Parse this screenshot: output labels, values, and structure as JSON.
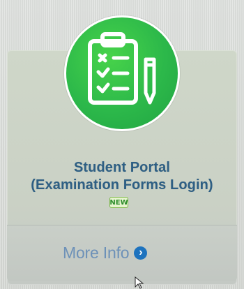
{
  "card": {
    "title_line_1": "Student Portal",
    "title_line_2": "(Examination Forms Login)",
    "badge_label": "NEW",
    "more_info_label": "More Info",
    "icon_name": "clipboard-checklist-icon",
    "arrow_icon_name": "chevron-right-circle-icon"
  },
  "colors": {
    "title": "#2e5f84",
    "icon_circle": "#2cb84a",
    "link": "#6d91b8",
    "arrow_circle": "#1e73be",
    "badge_border": "#7db84a"
  }
}
